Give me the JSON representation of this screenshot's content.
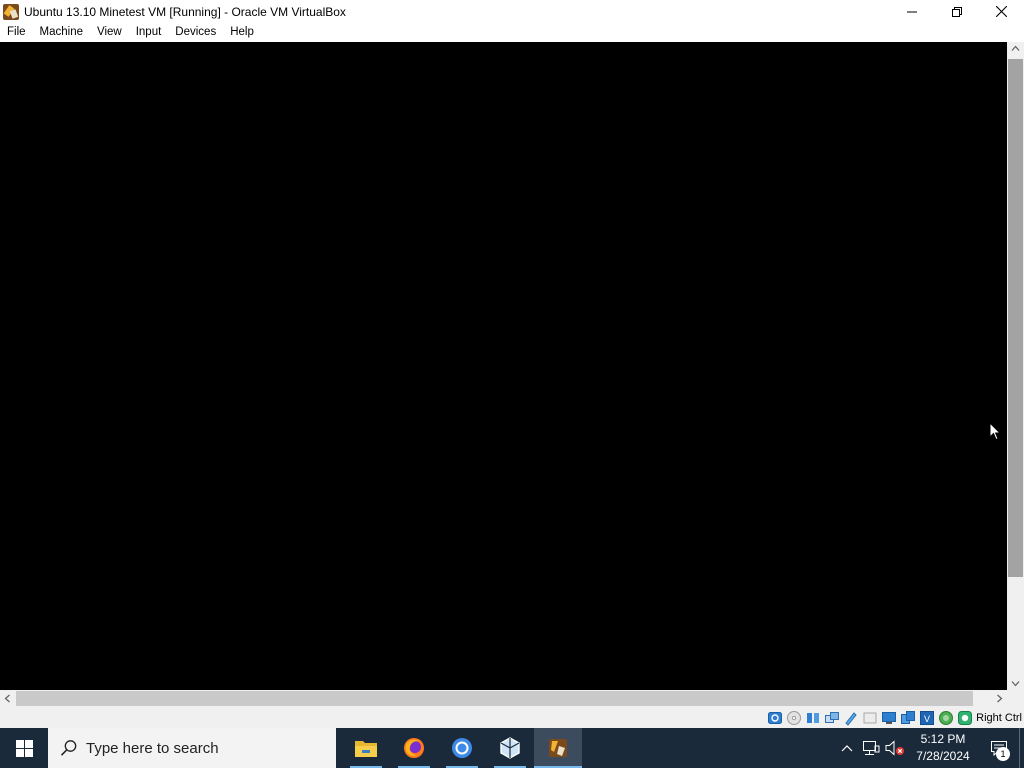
{
  "window": {
    "title": "Ubuntu 13.10 Minetest VM [Running] - Oracle VM VirtualBox",
    "icon": "virtualbox-app-icon",
    "controls": [
      "minimize-icon",
      "restore-icon",
      "close-icon"
    ]
  },
  "menu": {
    "items": [
      "File",
      "Machine",
      "View",
      "Input",
      "Devices",
      "Help"
    ]
  },
  "statusbar": {
    "icons": [
      "hard-disk-icon",
      "optical-drive-icon",
      "audio-icon",
      "network-icon",
      "usb-icon",
      "shared-folders-icon",
      "display-icon",
      "video-capture-icon",
      "mouse-integration-icon",
      "cpu-icon",
      "guest-additions-icon",
      "keyboard-capture-icon"
    ],
    "host_key": "Right Ctrl"
  },
  "taskbar": {
    "search_placeholder": "Type here to search",
    "apps": [
      "file-explorer-icon",
      "firefox-icon",
      "chrome-icon",
      "virtualbox-manager-icon",
      "virtualbox-vm-icon"
    ],
    "clock_time": "5:12 PM",
    "clock_date": "7/28/2024",
    "notification_count": "1"
  },
  "colors": {
    "taskbar": "#1b2a3b",
    "vm_background": "#000000",
    "accent": "#76b9ed"
  }
}
